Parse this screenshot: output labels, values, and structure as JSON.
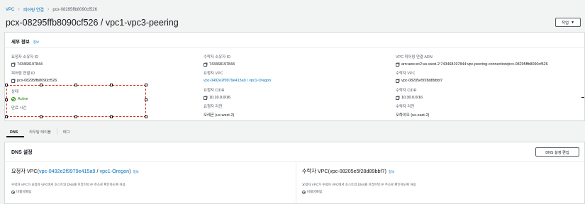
{
  "breadcrumb": {
    "root": "VPC",
    "section": "피어링 연결",
    "current": "pcx-08295ffb8090cf526"
  },
  "page": {
    "title": "pcx-08295ffb8090cf526 / vpc1-vpc3-peering",
    "action_label": "작업"
  },
  "details": {
    "header": "세부 정보",
    "info": "정보",
    "requester_owner": {
      "label": "요청자 소유자 ID",
      "value": "743468197844"
    },
    "peering_id": {
      "label": "피어링 연결 ID",
      "value": "pcx-08295ffb8090cf526"
    },
    "status": {
      "label": "상태",
      "value": "Active"
    },
    "expiration": {
      "label": "만료 시간"
    },
    "accepter_owner": {
      "label": "수락자 소유자 ID",
      "value": "743468197844"
    },
    "requester_vpc": {
      "label": "요청자 VPC",
      "value": "vpc-0492e2f9979e415a9 / vpc1-Oregon"
    },
    "requester_cidr": {
      "label": "요청자 CIDR",
      "value": "10.10.0.0/16"
    },
    "requester_region": {
      "label": "요청자 리전",
      "value": "오레곤 (us-west-2)"
    },
    "arn": {
      "label": "VPC 피어링 연결 ARN",
      "value": "arn:aws:ec2:us-west-2:743468197844:vpc-peering-connection/pcx-08295ffb8090cf526"
    },
    "accepter_vpc": {
      "label": "수락자 VPC",
      "value": "vpc-08205e5f28d89bbf7"
    },
    "accepter_cidr": {
      "label": "수락자 CIDR",
      "value": "10.30.0.0/16"
    },
    "accepter_region": {
      "label": "수락자 리전",
      "value": "오하이오 (us-east-2)"
    }
  },
  "tabs": [
    {
      "label": "DNS"
    },
    {
      "label": "라우팅 테이블"
    },
    {
      "label": "태그"
    }
  ],
  "dns": {
    "header": "DNS 설정",
    "edit_button": "DNS 설정 편집",
    "info": "정보",
    "requester": {
      "prefix": "요청자 VPC(",
      "vpc_link": "vpc-0492e2f9979e415a9",
      "sep": " / ",
      "name_link": "vpc1-Oregon",
      "suffix": ")",
      "desc": "수락자 VPC가 요청자 VPC에서 호스트의 DNS를 프라이빗 IP 주소로 확인하도록 허용",
      "status": "비활성화됨"
    },
    "accepter": {
      "title": "수락자 VPC(vpc-08205e5f28d89bbf7)",
      "desc": "요청자 VPC가 수락자 VPC에서 호스트의 DNS를 프라이빗 IP 주소로 확인하도록 허용",
      "status": "비활성화됨"
    }
  },
  "colors": {
    "link": "#0073bb",
    "active": "#1d8102",
    "selection": "#d13212",
    "text": "#16191f",
    "muted": "#545b64"
  }
}
